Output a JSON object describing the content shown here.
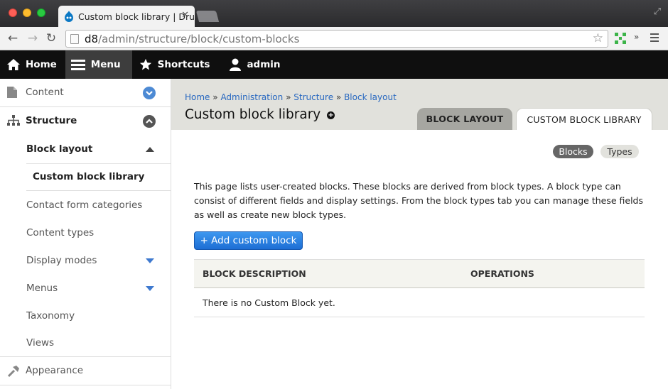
{
  "browser": {
    "tab_title": "Custom block library | Dru",
    "url_host": "d8",
    "url_path": "/admin/structure/block/custom-blocks"
  },
  "toolbar": {
    "items": [
      {
        "label": "Home",
        "icon": "home-icon"
      },
      {
        "label": "Menu",
        "icon": "hamburger-icon",
        "active": true
      },
      {
        "label": "Shortcuts",
        "icon": "star-icon"
      },
      {
        "label": "admin",
        "icon": "user-icon"
      }
    ]
  },
  "sidebar": {
    "items": [
      {
        "label": "Content",
        "icon": "file-icon"
      },
      {
        "label": "Structure",
        "icon": "sitemap-icon"
      },
      {
        "label": "Block layout"
      },
      {
        "label": "Custom block library"
      },
      {
        "label": "Contact form categories"
      },
      {
        "label": "Content types"
      },
      {
        "label": "Display modes"
      },
      {
        "label": "Menus"
      },
      {
        "label": "Taxonomy"
      },
      {
        "label": "Views"
      },
      {
        "label": "Appearance",
        "icon": "hammer-icon"
      }
    ]
  },
  "breadcrumb": {
    "items": [
      "Home",
      "Administration",
      "Structure",
      "Block layout"
    ],
    "separator": "»"
  },
  "page": {
    "title": "Custom block library",
    "tabs": [
      "BLOCK LAYOUT",
      "CUSTOM BLOCK LIBRARY"
    ],
    "secondary_tabs": [
      "Blocks",
      "Types"
    ],
    "description": "This page lists user-created blocks. These blocks are derived from block types. A block type can consist of different fields and display settings. From the block types tab you can manage these fields as well as create new block types.",
    "add_button": "+ Add custom block",
    "table": {
      "headers": [
        "BLOCK DESCRIPTION",
        "OPERATIONS"
      ],
      "empty": "There is no Custom Block yet."
    }
  },
  "colors": {
    "accent_blue": "#2868c0",
    "button_blue": "#1d6ed4",
    "toolbar_black": "#0f0f0f"
  }
}
